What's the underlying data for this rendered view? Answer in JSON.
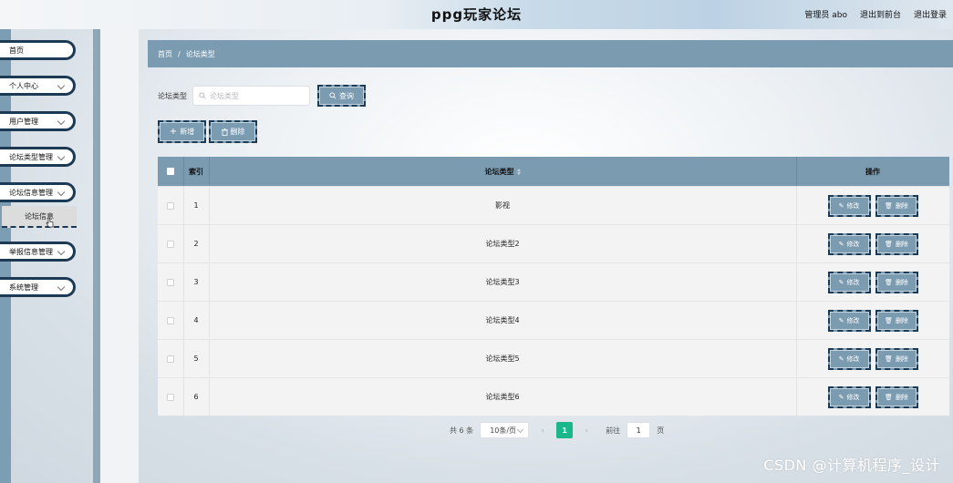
{
  "header": {
    "title": "ppg玩家论坛",
    "admin_label": "管理员 abo",
    "front_link": "退出到前台",
    "logout_link": "退出登录"
  },
  "sidebar": {
    "items": [
      {
        "label": "首页"
      },
      {
        "label": "个人中心"
      },
      {
        "label": "用户管理"
      },
      {
        "label": "论坛类型管理"
      },
      {
        "label": "论坛信息管理"
      },
      {
        "label": "举报信息管理"
      },
      {
        "label": "系统管理"
      }
    ],
    "submenu_active": "论坛信息"
  },
  "breadcrumb": {
    "home": "首页",
    "separator": "/",
    "current": "论坛类型"
  },
  "search": {
    "label": "论坛类型",
    "placeholder": "论坛类型",
    "button": "查询"
  },
  "actions": {
    "add": "新增",
    "delete": "删除"
  },
  "table": {
    "headers": {
      "index": "索引",
      "type": "论坛类型",
      "ops": "操作"
    },
    "rows": [
      {
        "index": "1",
        "type": "影视"
      },
      {
        "index": "2",
        "type": "论坛类型2"
      },
      {
        "index": "3",
        "type": "论坛类型3"
      },
      {
        "index": "4",
        "type": "论坛类型4"
      },
      {
        "index": "5",
        "type": "论坛类型5"
      },
      {
        "index": "6",
        "type": "论坛类型6"
      }
    ],
    "edit_label": "修改",
    "delete_label": "删除"
  },
  "pagination": {
    "total": "共 6 条",
    "page_size": "10条/页",
    "current_page": "1",
    "goto_label": "前往",
    "goto_value": "1",
    "page_unit": "页"
  },
  "watermark": "CSDN @计算机程序_设计",
  "colors": {
    "accent": "#7b9bb1",
    "border_dark": "#1d3a55",
    "page_active": "#19b78a"
  }
}
